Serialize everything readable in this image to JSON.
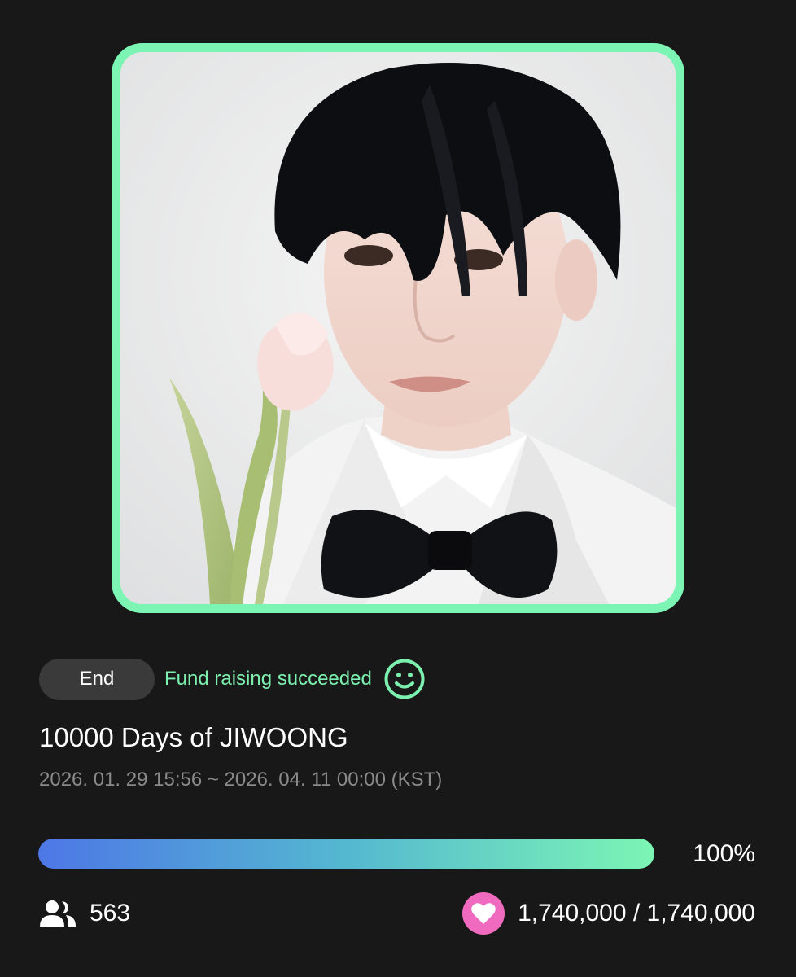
{
  "poster": {
    "frame_color": "#7cf5b4",
    "image_alt": "Portrait photo with tulip"
  },
  "status": {
    "badge_label": "End",
    "message": "Fund raising succeeded",
    "message_color": "#7cf0ae",
    "icon": "smile-icon"
  },
  "funding": {
    "title": "10000 Days of JIWOONG",
    "period": "2026. 01. 29 15:56 ~ 2026. 04. 11 00:00 (KST)"
  },
  "progress": {
    "percent_label": "100%",
    "fraction": 1.0,
    "gradient_start": "#4d77e6",
    "gradient_end": "#7cf5b4"
  },
  "stats": {
    "supporters_icon": "people-icon",
    "supporters_count": "563",
    "amount_icon": "heart-icon",
    "amount_color": "#f06bc0",
    "amount_label": "1,740,000 / 1,740,000"
  }
}
